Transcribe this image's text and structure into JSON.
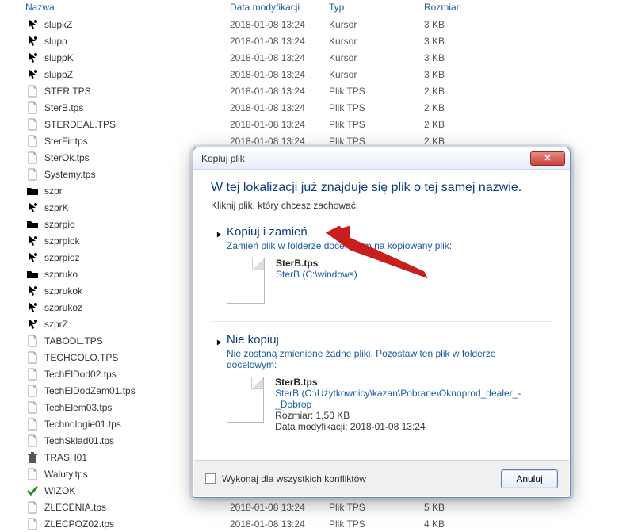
{
  "columns": {
    "name": "Nazwa",
    "date": "Data modyfikacji",
    "type": "Typ",
    "size": "Rozmiar"
  },
  "files": [
    {
      "icon": "cursor",
      "name": "slupkZ",
      "date": "2018-01-08 13:24",
      "type": "Kursor",
      "size": "3 KB"
    },
    {
      "icon": "cursor",
      "name": "slupp",
      "date": "2018-01-08 13:24",
      "type": "Kursor",
      "size": "3 KB"
    },
    {
      "icon": "cursor",
      "name": "sluppK",
      "date": "2018-01-08 13:24",
      "type": "Kursor",
      "size": "3 KB"
    },
    {
      "icon": "cursor",
      "name": "sluppZ",
      "date": "2018-01-08 13:24",
      "type": "Kursor",
      "size": "3 KB"
    },
    {
      "icon": "file",
      "name": "STER.TPS",
      "date": "2018-01-08 13:24",
      "type": "Plik TPS",
      "size": "2 KB"
    },
    {
      "icon": "file",
      "name": "SterB.tps",
      "date": "2018-01-08 13:24",
      "type": "Plik TPS",
      "size": "2 KB"
    },
    {
      "icon": "file",
      "name": "STERDEAL.TPS",
      "date": "2018-01-08 13:24",
      "type": "Plik TPS",
      "size": "2 KB"
    },
    {
      "icon": "file",
      "name": "SterFir.tps",
      "date": "2018-01-08 13:24",
      "type": "Plik TPS",
      "size": "2 KB"
    },
    {
      "icon": "file",
      "name": "SterOk.tps",
      "date": "",
      "type": "",
      "size": ""
    },
    {
      "icon": "file",
      "name": "Systemy.tps",
      "date": "",
      "type": "",
      "size": ""
    },
    {
      "icon": "folder",
      "name": "szpr",
      "date": "",
      "type": "",
      "size": ""
    },
    {
      "icon": "cursor",
      "name": "szprK",
      "date": "",
      "type": "",
      "size": ""
    },
    {
      "icon": "folder",
      "name": "szprpio",
      "date": "",
      "type": "",
      "size": ""
    },
    {
      "icon": "cursor",
      "name": "szprpiok",
      "date": "",
      "type": "",
      "size": ""
    },
    {
      "icon": "cursor",
      "name": "szprpioz",
      "date": "",
      "type": "",
      "size": ""
    },
    {
      "icon": "folder",
      "name": "szpruko",
      "date": "",
      "type": "",
      "size": ""
    },
    {
      "icon": "cursor",
      "name": "szprukok",
      "date": "",
      "type": "",
      "size": ""
    },
    {
      "icon": "cursor",
      "name": "szprukoz",
      "date": "",
      "type": "",
      "size": ""
    },
    {
      "icon": "cursor",
      "name": "szprZ",
      "date": "",
      "type": "",
      "size": ""
    },
    {
      "icon": "file",
      "name": "TABODL.TPS",
      "date": "",
      "type": "",
      "size": ""
    },
    {
      "icon": "file",
      "name": "TECHCOLO.TPS",
      "date": "",
      "type": "",
      "size": ""
    },
    {
      "icon": "file",
      "name": "TechElDod02.tps",
      "date": "",
      "type": "",
      "size": ""
    },
    {
      "icon": "file",
      "name": "TechElDodZam01.tps",
      "date": "",
      "type": "",
      "size": ""
    },
    {
      "icon": "file",
      "name": "TechElem03.tps",
      "date": "",
      "type": "",
      "size": ""
    },
    {
      "icon": "file",
      "name": "Technologie01.tps",
      "date": "",
      "type": "",
      "size": ""
    },
    {
      "icon": "file",
      "name": "TechSklad01.tps",
      "date": "",
      "type": "",
      "size": ""
    },
    {
      "icon": "trash",
      "name": "TRASH01",
      "date": "",
      "type": "",
      "size": ""
    },
    {
      "icon": "file",
      "name": "Waluty.tps",
      "date": "",
      "type": "",
      "size": ""
    },
    {
      "icon": "check",
      "name": "WIZOK",
      "date": "",
      "type": "",
      "size": ""
    },
    {
      "icon": "file",
      "name": "ZLECENIA.tps",
      "date": "2018-01-08 13:24",
      "type": "Plik TPS",
      "size": "5 KB"
    },
    {
      "icon": "file",
      "name": "ZLECPOZ02.tps",
      "date": "2018-01-08 13:24",
      "type": "Plik TPS",
      "size": "4 KB"
    }
  ],
  "dialog": {
    "title": "Kopiuj plik",
    "headline": "W tej lokalizacji już znajduje się plik o tej samej nazwie.",
    "subline": "Kliknij plik, który chcesz zachować.",
    "option1": {
      "title": "Kopiuj i zamień",
      "desc": "Zamień plik w folderze docelowym na kopiowany plik:",
      "file_name": "SterB.tps",
      "file_loc": "SterB (C:\\windows)"
    },
    "option2": {
      "title": "Nie kopiuj",
      "desc": "Nie zostaną zmienione żadne pliki. Pozostaw ten plik w folderze docelowym:",
      "file_name": "SterB.tps",
      "file_loc": "SterB (C:\\Użytkownicy\\kazan\\Pobrane\\Oknoprod_dealer_-_Dobrop",
      "file_size": "Rozmiar: 1,50 KB",
      "file_date": "Data modyfikacji: 2018-01-08 13:24"
    },
    "footer_checkbox_label": "Wykonaj dla wszystkich konfliktów",
    "cancel_label": "Anuluj"
  }
}
